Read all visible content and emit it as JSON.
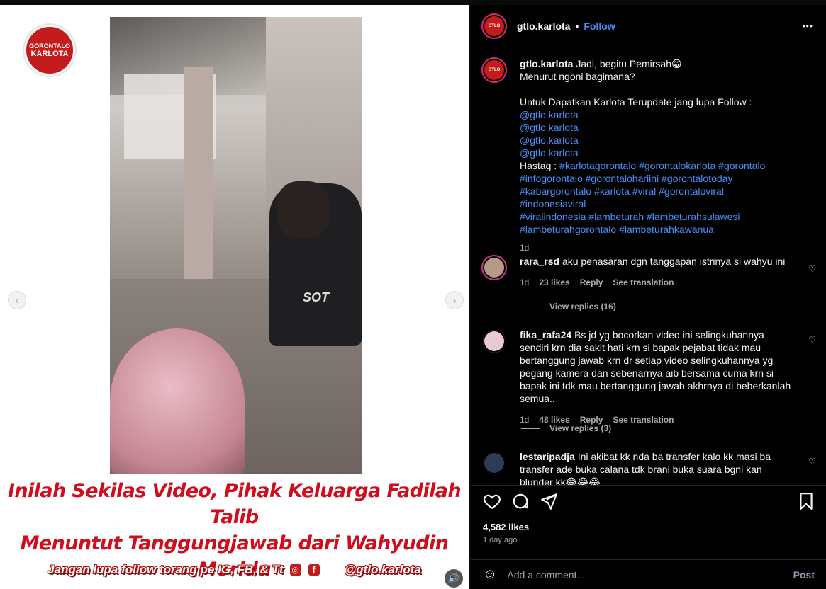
{
  "media": {
    "logo_line1": "GORONTALO",
    "logo_line2": "KARLOTA",
    "headline_line1": "Inilah Sekilas Video, Pihak Keluarga Fadilah Talib",
    "headline_line2": "Menuntut Tanggungjawab dari Wahyudin Moridu",
    "footer_text": "Jangan lupa follow torang pe IG, FB, & Tt",
    "footer_handle": "@gtlo.karlota",
    "footer_icons": [
      "instagram-icon",
      "facebook-icon",
      "tiktok-icon"
    ],
    "nav_prev": "‹",
    "nav_next": "›",
    "mute_icon": "speaker-icon",
    "video_overlay_text": "SOT"
  },
  "header": {
    "username": "gtlo.karlota",
    "separator": "•",
    "follow_label": "Follow",
    "more_icon": "•••"
  },
  "caption": {
    "username": "gtlo.karlota",
    "lines": [
      "Jadi, begitu Pemirsah😁",
      "Menurut ngoni bagimana?",
      "",
      "Untuk Dapatkan Karlota Terupdate jang lupa Follow :"
    ],
    "mentions": [
      "@gtlo.karlota",
      "@gtlo.karlota",
      "@gtlo.karlota",
      "@gtlo.karlota"
    ],
    "hashtag_label": "Hastag : ",
    "hashtags_line1": "#karlotagorontalo #gorontalokarlota #gorontalo",
    "hashtags_line2": "#infogorontalo #gorontalohariini #gorontalotoday",
    "hashtags_line3": "#kabargorontalo #karlota #viral #gorontaloviral #indonesiaviral",
    "hashtags_line4": "#viralindonesia #lambeturah #lambeturahsulawesi",
    "hashtags_line5": "#lambeturahgorontalo #lambeturahkawanua",
    "time": "1d"
  },
  "comments": [
    {
      "username": "rara_rsd",
      "text": "aku penasaran dgn tanggapan istrinya si wahyu ini",
      "time": "1d",
      "likes": "23 likes",
      "reply": "Reply",
      "translate": "See translation",
      "view_replies": "View replies (16)"
    },
    {
      "username": "fika_rafa24",
      "text": "Bs jd yg bocorkan video ini selingkuhannya sendiri krn dia sakit hati krn si bapak pejabat tidak mau bertanggung jawab krn dr setiap video selingkuhannya yg pegang kamera dan sebenarnya aib bersama cuma krn si bapak ini tdk mau bertanggung jawab akhrnya di beberkanlah semua..",
      "time": "1d",
      "likes": "48 likes",
      "reply": "Reply",
      "translate": "See translation",
      "view_replies": "View replies (3)"
    },
    {
      "username": "lestaripadja",
      "text": "Ini akibat kk nda ba transfer kalo kk masi ba transfer ade buka calana tdk brani buka suara bgni kan blunder kk😂😂😂"
    }
  ],
  "actions": {
    "like_icon": "heart-icon",
    "comment_icon": "comment-icon",
    "share_icon": "share-icon",
    "save_icon": "bookmark-icon",
    "likes": "4,582 likes",
    "posted": "1 day ago"
  },
  "add_comment": {
    "emoji_icon": "emoji-icon",
    "placeholder": "Add a comment...",
    "post_label": "Post"
  },
  "colors": {
    "accent_blue": "#4a8ef6",
    "headline_red": "#d10c1c",
    "panel_bg": "#000000"
  }
}
